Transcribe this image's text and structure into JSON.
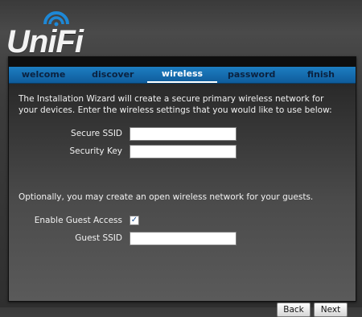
{
  "brand": {
    "name": "UniFi"
  },
  "tabs": [
    {
      "label": "welcome",
      "active": false
    },
    {
      "label": "discover",
      "active": false
    },
    {
      "label": "wireless",
      "active": true
    },
    {
      "label": "password",
      "active": false
    },
    {
      "label": "finish",
      "active": false
    }
  ],
  "intro_text": "The Installation Wizard will create a secure primary wireless network for your devices. Enter the wireless settings that you would like to use below:",
  "fields": {
    "secure_ssid": {
      "label": "Secure SSID",
      "value": ""
    },
    "security_key": {
      "label": "Security Key",
      "value": ""
    },
    "guest_ssid": {
      "label": "Guest SSID",
      "value": ""
    }
  },
  "optional_text": "Optionally, you may create an open wireless network for your guests.",
  "guest_access": {
    "label": "Enable Guest Access",
    "checked": true,
    "mark": "✓"
  },
  "buttons": {
    "back": "Back",
    "next": "Next"
  },
  "colors": {
    "tab_bar": "#1d7ec2",
    "tab_text": "#0b2240",
    "tab_active_text": "#ffffff"
  }
}
